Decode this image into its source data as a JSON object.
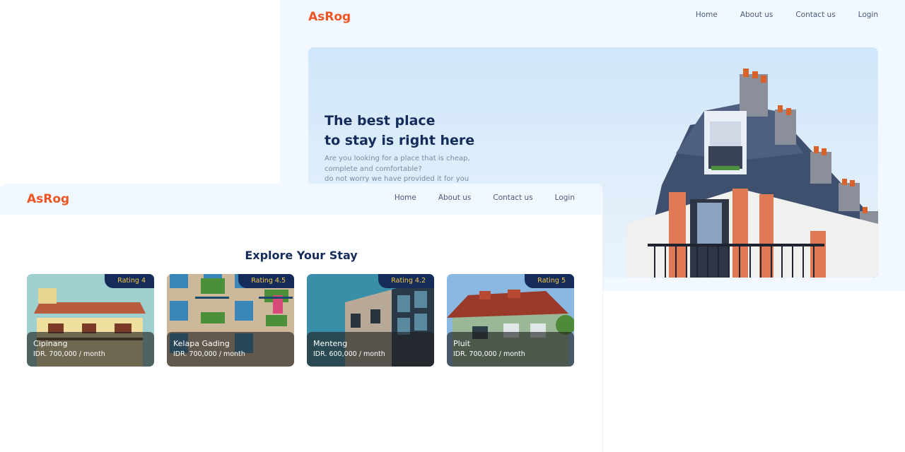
{
  "back": {
    "logo": "AsRog",
    "nav": [
      "Home",
      "About us",
      "Contact us",
      "Login"
    ],
    "hero": {
      "title_line1": "The best place",
      "title_line2": "to stay is right here",
      "sub_line1": "Are you looking for a place that is cheap,",
      "sub_line2": "complete and comfortable?",
      "sub_line3": "do not worry we have provided it for you"
    }
  },
  "front": {
    "logo": "AsRog",
    "nav": [
      "Home",
      "About us",
      "Contact us",
      "Login"
    ],
    "section_title": "Explore Your Stay",
    "cards": [
      {
        "rating": "Rating 4",
        "name": "Cipinang",
        "price": "IDR. 700,000 / month"
      },
      {
        "rating": "Rating 4.5",
        "name": "Kelapa Gading",
        "price": "IDR. 700,000 / month"
      },
      {
        "rating": "Rating 4.2",
        "name": "Menteng",
        "price": "IDR. 600,000 / month"
      },
      {
        "rating": "Rating 5",
        "name": "Pluit",
        "price": "IDR. 700,000 / month"
      }
    ]
  },
  "colors": {
    "brand": "#ee5522",
    "navy": "#152c5b",
    "rating_text": "#f7c948",
    "header_bg": "#f1f8ff"
  }
}
